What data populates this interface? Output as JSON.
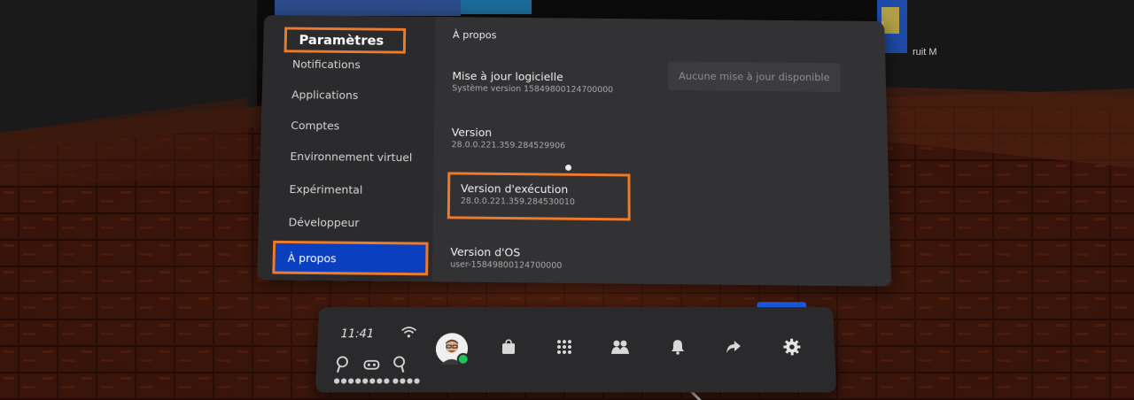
{
  "sidebar": {
    "title": "Paramètres",
    "items": [
      {
        "label": "Notifications"
      },
      {
        "label": "Applications"
      },
      {
        "label": "Comptes"
      },
      {
        "label": "Environnement virtuel"
      },
      {
        "label": "Expérimental"
      },
      {
        "label": "Développeur"
      },
      {
        "label": "À propos",
        "active": true
      }
    ]
  },
  "content": {
    "heading": "À propos",
    "update_button": "Aucune mise à jour disponible",
    "rows": [
      {
        "title": "Mise à jour logicielle",
        "subtitle": "Système version 15849800124700000"
      },
      {
        "title": "Version",
        "subtitle": "28.0.0.221.359.284529906"
      },
      {
        "title": "Version d'exécution",
        "subtitle": "28.0.0.221.359.284530010"
      },
      {
        "title": "Version d'OS",
        "subtitle": "user-15849800124700000"
      }
    ]
  },
  "background": {
    "partial_text": "ruit M"
  },
  "dock": {
    "time": "11:41",
    "icons": [
      "wifi-icon",
      "store-icon",
      "apps-grid-icon",
      "people-icon",
      "notifications-bell-icon",
      "share-icon",
      "settings-gear-icon"
    ],
    "devices": [
      "left-controller-icon",
      "headset-icon",
      "right-controller-icon"
    ],
    "online_color": "#22c35a"
  },
  "colors": {
    "highlight": "#f07a2a",
    "active_item": "#0a3fbf"
  }
}
